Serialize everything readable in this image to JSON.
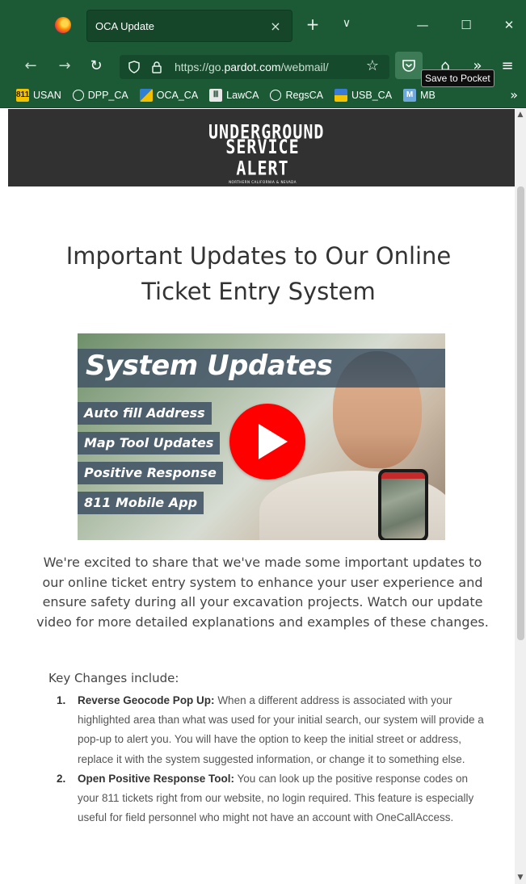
{
  "browser": {
    "tab_title": "OCA Update",
    "tab_close": "×",
    "new_tab": "+",
    "tab_list": "∨",
    "minimize": "—",
    "maximize": "☐",
    "close": "✕",
    "url_prefix": "https://go.",
    "url_domain": "pardot.com",
    "url_suffix": "/webmail/",
    "tooltip": "Save to Pocket",
    "bookmarks": [
      {
        "label": "USAN",
        "icon": "811-icon"
      },
      {
        "label": "DPP_CA",
        "icon": "globe-icon"
      },
      {
        "label": "OCA_CA",
        "icon": "site-icon"
      },
      {
        "label": "LawCA",
        "icon": "law-icon"
      },
      {
        "label": "RegsCA",
        "icon": "globe-icon"
      },
      {
        "label": "USB_CA",
        "icon": "site-icon"
      },
      {
        "label": "MB",
        "icon": "site-icon"
      }
    ]
  },
  "header": {
    "logo_line1": "UNDERGROUND",
    "logo_line2": "SERVICE ALERT",
    "logo_sub": "NORTHERN CALIFORNIA & NEVADA"
  },
  "page": {
    "title": "Important Updates to Our Online Ticket Entry System",
    "video": {
      "title": "System Updates",
      "features": [
        "Auto fill Address",
        "Map Tool Updates",
        "Positive Response",
        "811 Mobile App"
      ]
    },
    "intro": "We're excited to share that we've made some important updates to our online ticket entry system to enhance your user experience and ensure safety during all your excavation projects. Watch our update video for more detailed explanations and examples of these changes.",
    "key_changes_heading": "Key Changes include:",
    "key_changes": [
      {
        "number": "1.",
        "lead": "Reverse Geocode Pop Up:",
        "text": " When a different address is associated with your highlighted area than what was used for your initial search, our system will provide a pop-up to alert you. You will have the option to keep the initial street or address, replace it with the system suggested information, or change it to something else."
      },
      {
        "number": "2.",
        "lead": "Open Positive Response Tool:",
        "text": " You can look up the positive response codes on your 811 tickets right from our website, no login required. This feature is especially useful for field personnel who might not have an account with OneCallAccess."
      }
    ]
  },
  "colors": {
    "chrome": "#1c5a36",
    "header_bg": "#313131",
    "play_button": "#ff0000",
    "feature_pill": "#465868"
  }
}
